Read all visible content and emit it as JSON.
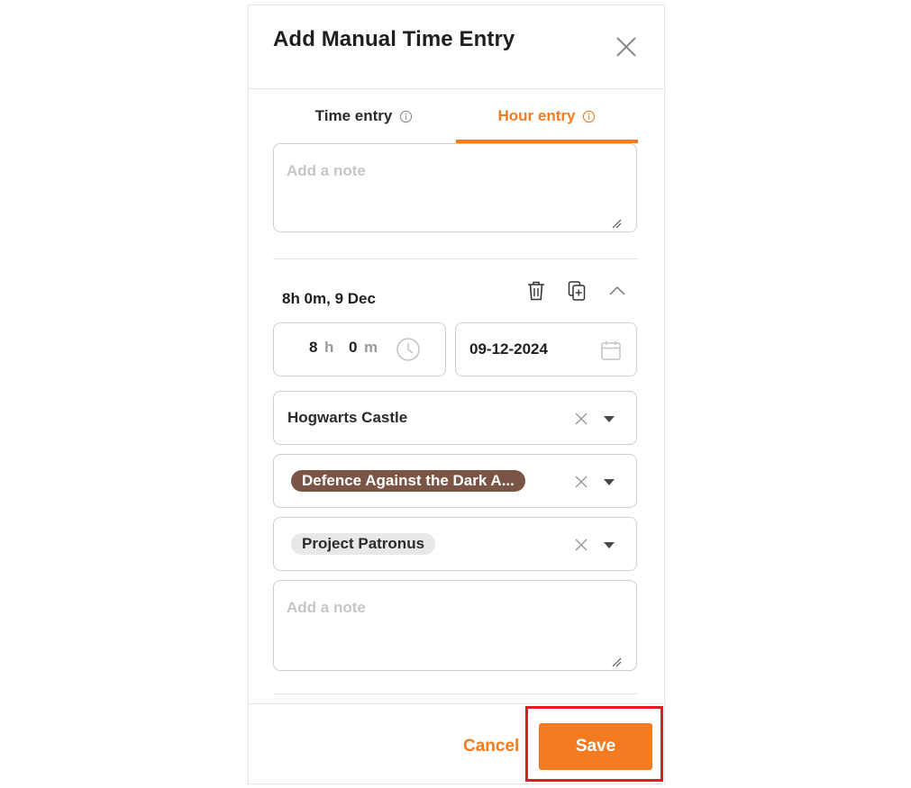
{
  "modal": {
    "title": "Add Manual Time Entry"
  },
  "tabs": [
    {
      "label": "Time entry",
      "active": false
    },
    {
      "label": "Hour entry",
      "active": true
    }
  ],
  "top_note": {
    "placeholder": "Add a note",
    "value": ""
  },
  "entry": {
    "summary": "8h 0m, 9 Dec",
    "duration": {
      "hours": "8",
      "hours_unit": "h",
      "minutes": "0",
      "minutes_unit": "m"
    },
    "date": "09-12-2024",
    "workspace": "Hogwarts Castle",
    "task_tag": "Defence Against the Dark A...",
    "project_tag": "Project Patronus",
    "note": {
      "placeholder": "Add a note",
      "value": ""
    }
  },
  "footer": {
    "cancel_label": "Cancel",
    "save_label": "Save"
  },
  "colors": {
    "accent": "#f47b20",
    "tag_brown": "#7a5444",
    "tag_grey": "#e8e8e8",
    "highlight": "#e01b24"
  },
  "icons": [
    "close-icon",
    "info-icon",
    "trash-icon",
    "duplicate-icon",
    "chevron-up-icon",
    "clock-icon",
    "calendar-icon",
    "clear-icon",
    "caret-down-icon"
  ]
}
